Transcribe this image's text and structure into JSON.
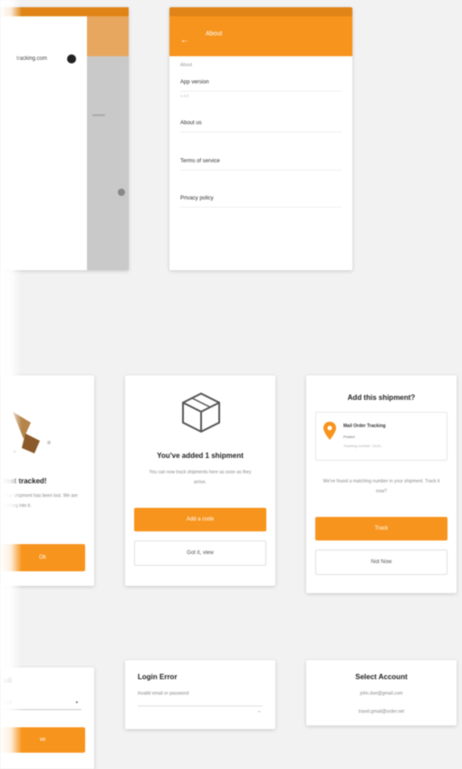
{
  "drawer_phone": {
    "email": "tracking.com"
  },
  "settings_phone": {
    "title": "About",
    "section_label": "About",
    "items": [
      {
        "label": "App version",
        "sub": "1.1.0"
      },
      {
        "label": "About us"
      },
      {
        "label": "Terms of service"
      },
      {
        "label": "Privacy policy"
      }
    ]
  },
  "card_left": {
    "headline": "lost tracked!",
    "body": "Your shipment has been lost. We are looking into it.",
    "button": "Ok"
  },
  "card_mid": {
    "headline": "You've added 1 shipment",
    "body": "You can now track shipments here as soon as they arrive.",
    "primary": "Add a code",
    "secondary": "Got it, view"
  },
  "card_right": {
    "headline": "Add this shipment?",
    "shipment_title": "Mail Order Tracking",
    "shipment_status": "Posted",
    "shipment_meta": "Tracking number: 2123...",
    "body": "We've found a matching number in your shipment. Track it now?",
    "primary": "Track",
    "secondary": "Not Now"
  },
  "card_bottom_left": {
    "headline": "ail",
    "field": "mail",
    "button": "ve"
  },
  "card_bottom_mid": {
    "headline": "Login Error",
    "body": "Invalid email or password"
  },
  "card_bottom_right": {
    "headline": "Select Account",
    "account1": "john.doe@gmail.com",
    "account2": "travel.gmail@order.net"
  },
  "colors": {
    "accent": "#f7941d",
    "accent_dark": "#e08418",
    "background": "#f2f2f2"
  }
}
